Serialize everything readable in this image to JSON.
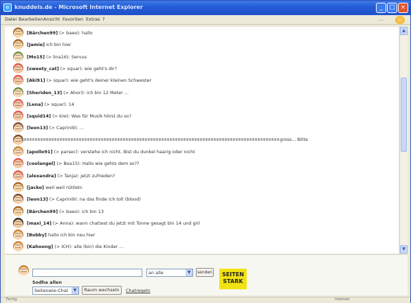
{
  "window": {
    "title": "knuddels.de - Microsoft Internet Explorer",
    "controls": {
      "minimize": "_",
      "maximize": "□",
      "close": "×"
    }
  },
  "menu": [
    "Datei",
    "Bearbeiten",
    "Ansicht",
    "Favoriten",
    "Extras",
    "?"
  ],
  "address_hint": "...",
  "chat": {
    "messages": [
      {
        "nick": "[Bärchen99]",
        "text": " (> baeo): hallo",
        "avatar": "av-a"
      },
      {
        "nick": "[Jamie]",
        "text": " ich bin hier",
        "avatar": "av-a"
      },
      {
        "nick": "[Mo15]",
        "text": " (> lina16): Servus",
        "avatar": "av-c"
      },
      {
        "nick": "[sweety_cat]",
        "text": " (> squar): wie geht's dir?",
        "avatar": "av-b"
      },
      {
        "nick": "[Aki91]",
        "text": " (> squar): wie geht's deiner kleinen Schwester",
        "avatar": "av-b"
      },
      {
        "nick": "[Sheriden_13]",
        "text": " (> Ahori): ich bin 12 Meter ...",
        "avatar": "av-c"
      },
      {
        "nick": "[Lena]",
        "text": " (> squar): 14",
        "avatar": "av-b"
      },
      {
        "nick": "[squid14]",
        "text": " (> kiw): Was für Musik hörst du so?",
        "avatar": "av-b"
      },
      {
        "nick": "[leon13]",
        "text": " (> Caprini9): ...",
        "avatar": "av-f"
      },
      {
        "nick": "",
        "text": " gross... Bitte",
        "avatar": "av-f",
        "long": true
      },
      {
        "nick": "[apollo91]",
        "text": " (> parsec): verstehe ich nicht. Bist du dunkel haarig oder nicht",
        "avatar": "av-e"
      },
      {
        "nick": "[coolangel]",
        "text": " (> Bea15): Hallo wie gehts dem so??",
        "avatar": "av-b"
      },
      {
        "nick": "[alexandra]",
        "text": " (> Tanja): jetzt zufrieden?",
        "avatar": "av-b"
      },
      {
        "nick": "[jacko]",
        "text": " weil weil rüttleln",
        "avatar": "av-a"
      },
      {
        "nick": "[leon13]",
        "text": " (> Caprini9): na das finde ich toll (blood)",
        "avatar": "av-f"
      },
      {
        "nick": "[Bärchen99]",
        "text": " (> baeo): ich bin 13",
        "avatar": "av-a"
      },
      {
        "nick": "[maxi_14]",
        "text": " (> Anna): wann chattest du jetzt mit Tonne gesagt bin 14 und girl",
        "avatar": "av-d"
      },
      {
        "nick": "[Bobby]",
        "text": " hallo ich bin neu hier",
        "avatar": "av-e"
      },
      {
        "nick": "[Kahoong]",
        "text": " (> ICH): alle (bin) die Kinder ...",
        "avatar": "av-e"
      }
    ]
  },
  "input": {
    "message_value": "",
    "to_value": "an alle",
    "send_label": "senden",
    "small_label": "Sodha allen",
    "room_value": "Seitenwie-Chat",
    "room_button": "Raum wechseln",
    "rules_link": "Chatregeln",
    "promo_text": "SEITEN STARK"
  },
  "status": {
    "left": "Fertig",
    "zone": "Internet"
  },
  "icons": {
    "app": "ie-icon",
    "toolbar": "go-icon",
    "scroll_up": "scroll-up-icon",
    "scroll_down": "scroll-down-icon",
    "select_arrow": "chevron-down-icon"
  },
  "colors": {
    "titlebar": "#245dd7",
    "close": "#e0542f",
    "promo": "#f1e313",
    "scroll_thumb": "#c8d7f5"
  }
}
